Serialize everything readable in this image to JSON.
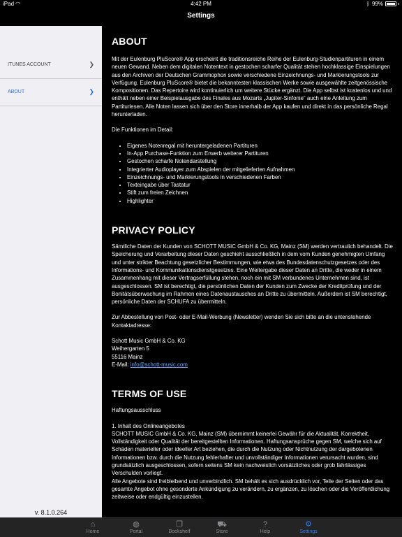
{
  "status": {
    "carrier": "iPad",
    "wifi_icon": "wifi-icon",
    "time": "4:42 PM",
    "battery": "99%",
    "battery_level": 0.99,
    "bluetooth_icon": "bluetooth-icon"
  },
  "nav": {
    "title": "Settings"
  },
  "sidebar": {
    "items": [
      {
        "label": "ITUNES ACCOUNT",
        "chevron": "❯"
      },
      {
        "label": "ABOUT",
        "chevron": "❯"
      }
    ],
    "version": "v. 8.1.0.264"
  },
  "about": {
    "heading": "ABOUT",
    "intro": "Mit der Eulenburg PluScore® App erscheint die traditionsreiche Reihe der Eulenburg-Studienpartituren in einem neuen Gewand. Neben dem digitalen Notentext in gestochen scharfer Qualität stehen hochklassige Einspielungen aus den Archiven der Deutschen Grammophon sowie verschiedene Einzeichnungs- und Markierungstools zur Verfügung. Eulenburg PluScore® bietet die bekanntesten klassischen Werke sowie ausgewählte zeitgenössische Kompositionen. Das Repertoire wird kontinuierlich um weitere Stücke ergänzt. Die App selbst ist kostenlos und und enthält neben einer Beispielausgabe des Finales aus Mozarts „Jupiter-Sinfonie“ auch eine Anleitung zum Partiturlesen. Alle Noten lassen sich über den Store innerhalb der App kaufen und direkt in das persönliche Regal herunterladen.",
    "features_title": "Die Funktionen im Detail:",
    "features": [
      "Eigenes Notenregal mit heruntergeladenen Partituren",
      "In-App Purchase-Funktion zum Erwerb weiterer Partituren",
      "Gestochen scharfe Notendarstellung",
      "Integrierter Audioplayer zum Abspielen der mitgelieferten Aufnahmen",
      "Einzeichnungs- und Markierungstools in verschiedenen Farben",
      "Texteingabe über Tastatur",
      "Stift zum freien Zeichnen",
      "Highlighter"
    ]
  },
  "privacy": {
    "heading": "PRIVACY POLICY",
    "body": "Sämtliche Daten der Kunden von SCHOTT MUSIC GmbH & Co. KG, Mainz (SM) werden vertraulich behandelt. Die Speicherung und Verarbeitung dieser Daten geschieht ausschließlich in dem vom Kunden genehmigten Umfang und unter strikter Beachtung gesetzlicher Bestimmungen, wie etwa des Bundesdatenschutzgesetzes oder des Informations- und Kommunikationsdienstgesetzes. Eine Weitergabe dieser Daten an Dritte, die weder in einem Zusammenhang mit dieser Vertragserfüllung stehen, noch ein mit SM verbundenes Unternehmen sind, ist ausgeschlossen. SM ist berechtigt, die persönlichen Daten der Kunden zum Zwecke der Kreditprüfung und der Bonitätsüberwachung im Rahmen eines Datenaustausches an Dritte zu übermitteln. Außerdem ist SM berechtigt, persönliche Daten der SCHUFA zu übermitteln.",
    "unsubscribe": "Zur Abbestellung von Post- oder E-Mail-Werbung (Newsletter) wenden Sie sich bitte an die untenstehende Kontaktadresse:",
    "address_name": "Schott Music GmbH & Co. KG",
    "address_street": "Weihergarten 5",
    "address_city": "55116 Mainz",
    "email_label": "E-Mail: ",
    "email": "info@schott-music.com"
  },
  "terms": {
    "heading": "TERMS OF USE",
    "subtitle": "Haftungsausschluss",
    "section1_title": "1. Inhalt des Onlineangebotes",
    "section1_body": "SCHOTT MUSIC GmbH & Co. KG, Mainz (SM) übernimmt keinerlei Gewähr für die Aktualität, Korrektheit, Vollständigkeit oder Qualität der bereitgestellten Informationen. Haftungsansprüche gegen SM, welche sich auf Schäden materieller oder ideeller Art beziehen, die durch die Nutzung oder Nichtnutzung der dargebotenen Informationen bzw. durch die Nutzung fehlerhafter und unvollständiger Informationen verursacht wurden, sind grundsätzlich ausgeschlossen, sofern seitens SM kein nachweislich vorsätzliches oder grob fahrlässiges Verschulden vorliegt.",
    "section1_body2": "Alle Angebote sind freibleibend und unverbindlich. SM behält es sich ausdrücklich vor, Teile der Seiten oder das gesamte Angebot ohne gesonderte Ankündigung zu verändern, zu ergänzen, zu löschen oder die Veröffentlichung zeitweise oder endgültig einzustellen."
  },
  "tabs": [
    {
      "label": "Home",
      "icon": "home-icon",
      "glyph": "⌂"
    },
    {
      "label": "Portal",
      "icon": "globe-icon",
      "glyph": "◍"
    },
    {
      "label": "Bookshelf",
      "icon": "book-icon",
      "glyph": "❒"
    },
    {
      "label": "Store",
      "icon": "cart-icon",
      "glyph": "⛟"
    },
    {
      "label": "Help",
      "icon": "help-icon",
      "glyph": "?"
    },
    {
      "label": "Settings",
      "icon": "gear-icon",
      "glyph": "⚙"
    }
  ],
  "colors": {
    "accent": "#2f7cf6",
    "sidebar_bg": "#efeff4",
    "tabbar_bg": "#242424"
  }
}
